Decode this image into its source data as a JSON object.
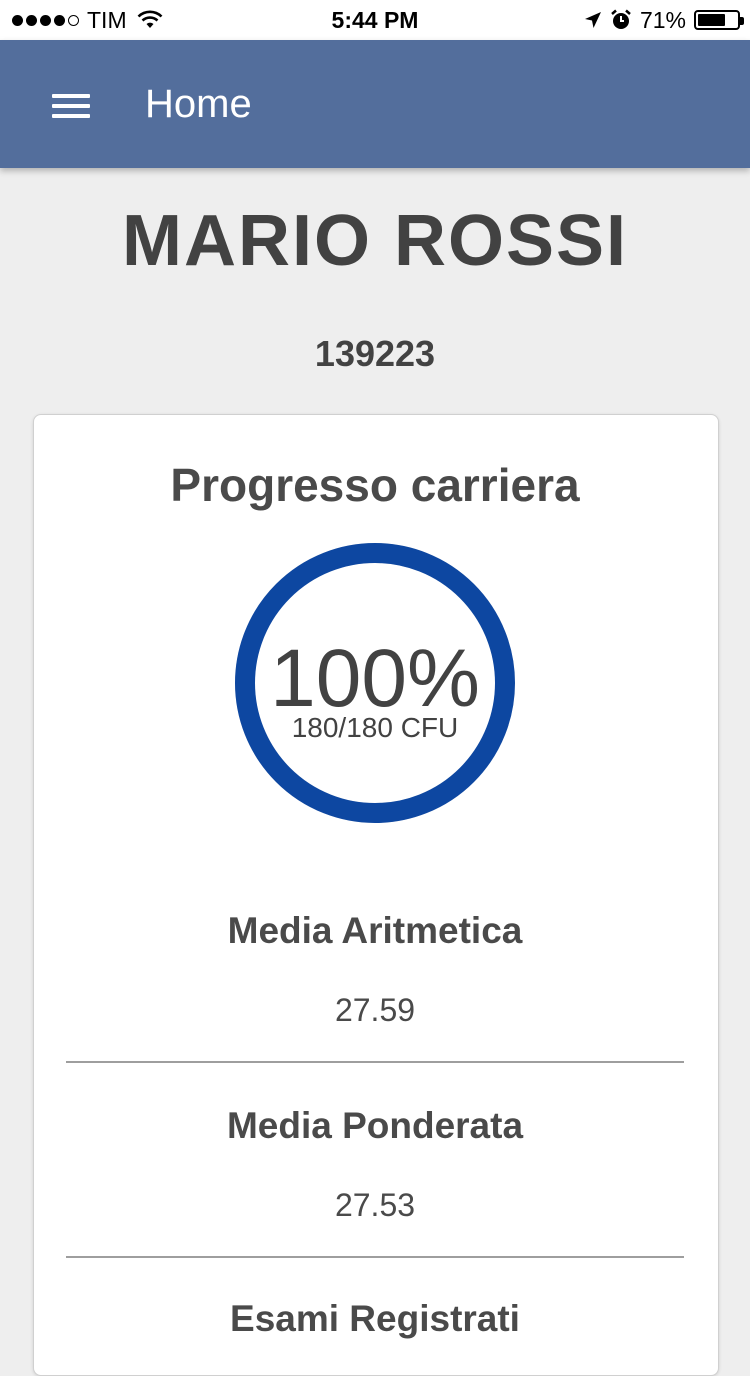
{
  "status_bar": {
    "carrier": "TIM",
    "time": "5:44 PM",
    "battery": "71%",
    "battery_level": 0.71,
    "signal_bars_filled": 4,
    "signal_bars_total": 5
  },
  "header": {
    "title": "Home",
    "menu_icon": "hamburger-menu-icon",
    "color": "#536e9c"
  },
  "profile": {
    "name": "MARIO ROSSI",
    "id": "139223"
  },
  "career": {
    "title": "Progresso carriera",
    "percent_label": "100%",
    "percent": 100,
    "credits_label": "180/180 CFU",
    "ring_color": "#0d47a1"
  },
  "stats": [
    {
      "label": "Media Aritmetica",
      "value": "27.59"
    },
    {
      "label": "Media Ponderata",
      "value": "27.53"
    },
    {
      "label": "Esami Registrati"
    }
  ]
}
